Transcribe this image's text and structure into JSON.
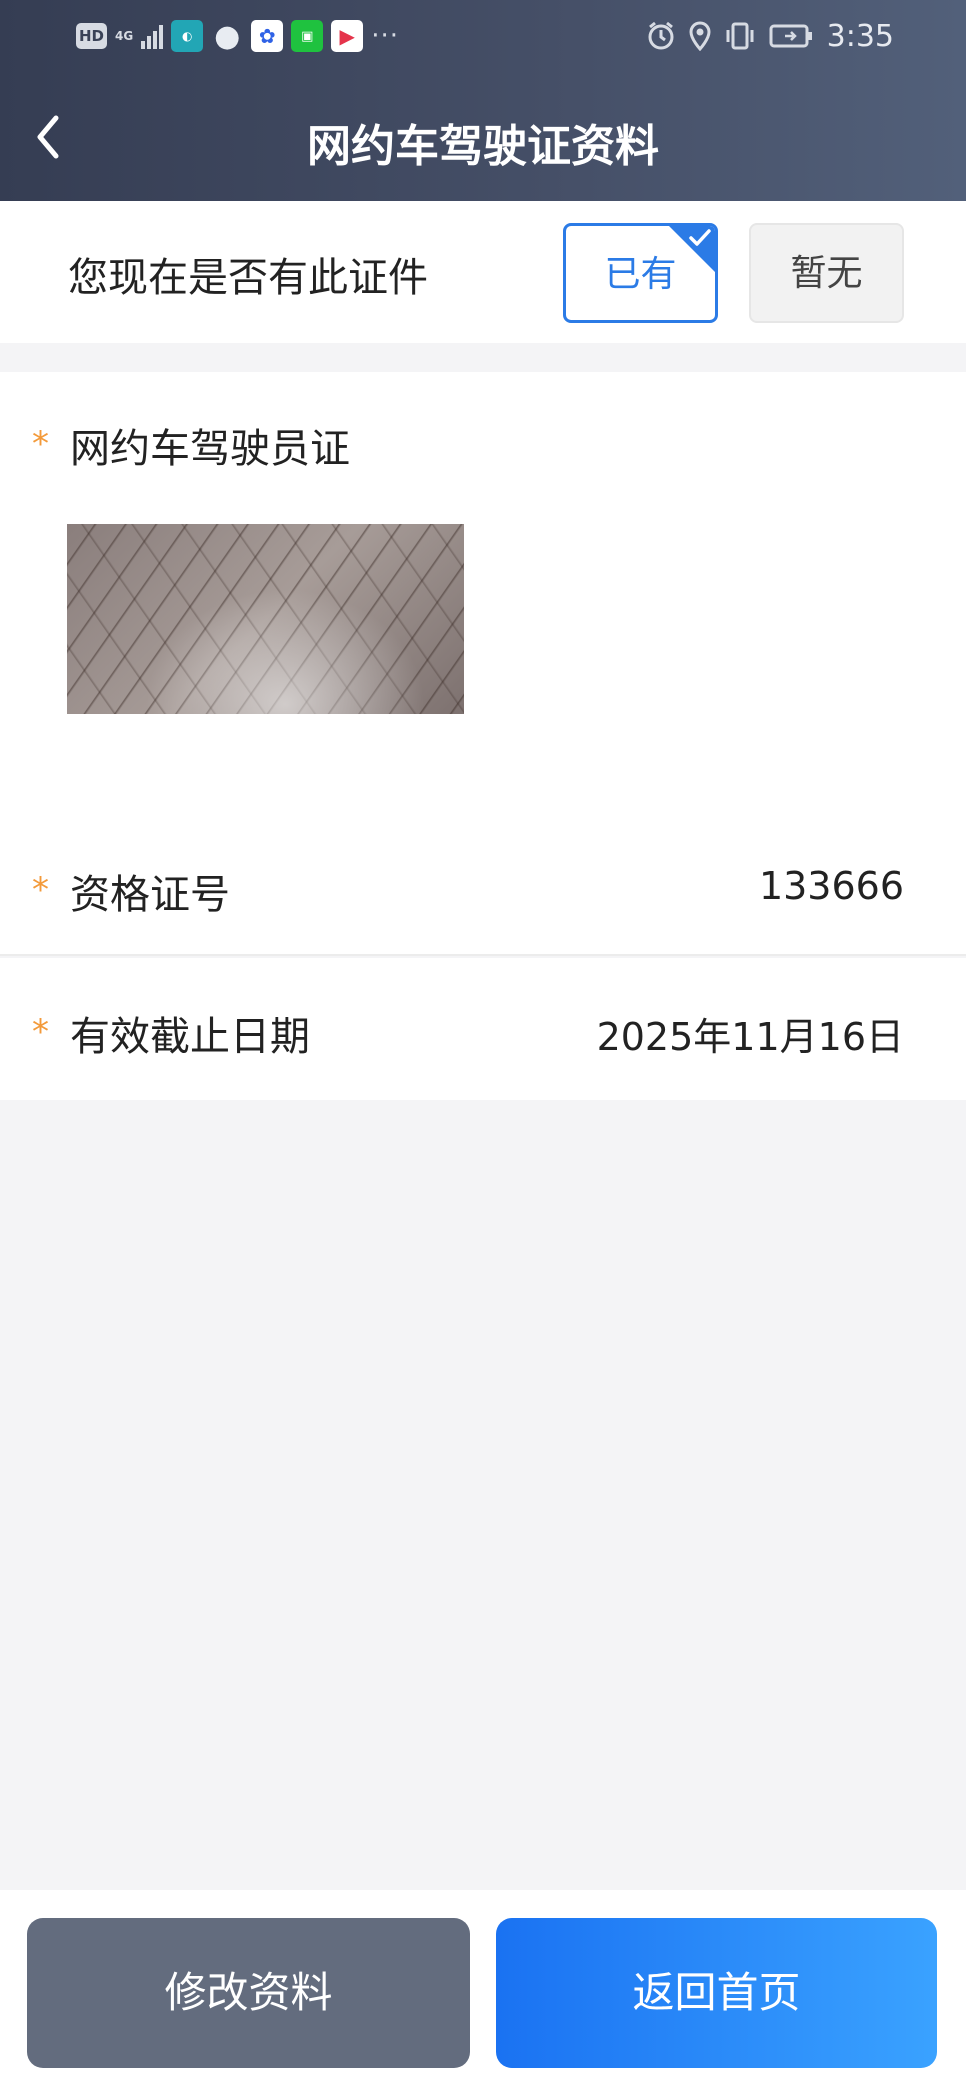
{
  "status_bar": {
    "hd": "HD",
    "network": "4G",
    "app_icons": [
      "didi-icon",
      "wechat-icon",
      "baidu-icon",
      "iqiyi-icon",
      "youku-icon"
    ],
    "overflow": "···",
    "time": "3:35"
  },
  "header": {
    "title": "网约车驾驶证资料",
    "background": "#3d465d"
  },
  "question": {
    "text": "您现在是否有此证件",
    "options": [
      {
        "label": "已有",
        "selected": true
      },
      {
        "label": "暂无",
        "selected": false
      }
    ]
  },
  "license": {
    "label": "网约车驾驶员证",
    "required_mark": "*"
  },
  "fields": [
    {
      "label": "资格证号",
      "value": "133666",
      "required_mark": "*"
    },
    {
      "label": "有效截止日期",
      "value": "2025年11月16日",
      "required_mark": "*"
    }
  ],
  "actions": {
    "edit_label": "修改资料",
    "home_label": "返回首页"
  },
  "colors": {
    "accent": "#2b7be6",
    "required": "#f39a3a",
    "edit_button": "#636c7e"
  }
}
